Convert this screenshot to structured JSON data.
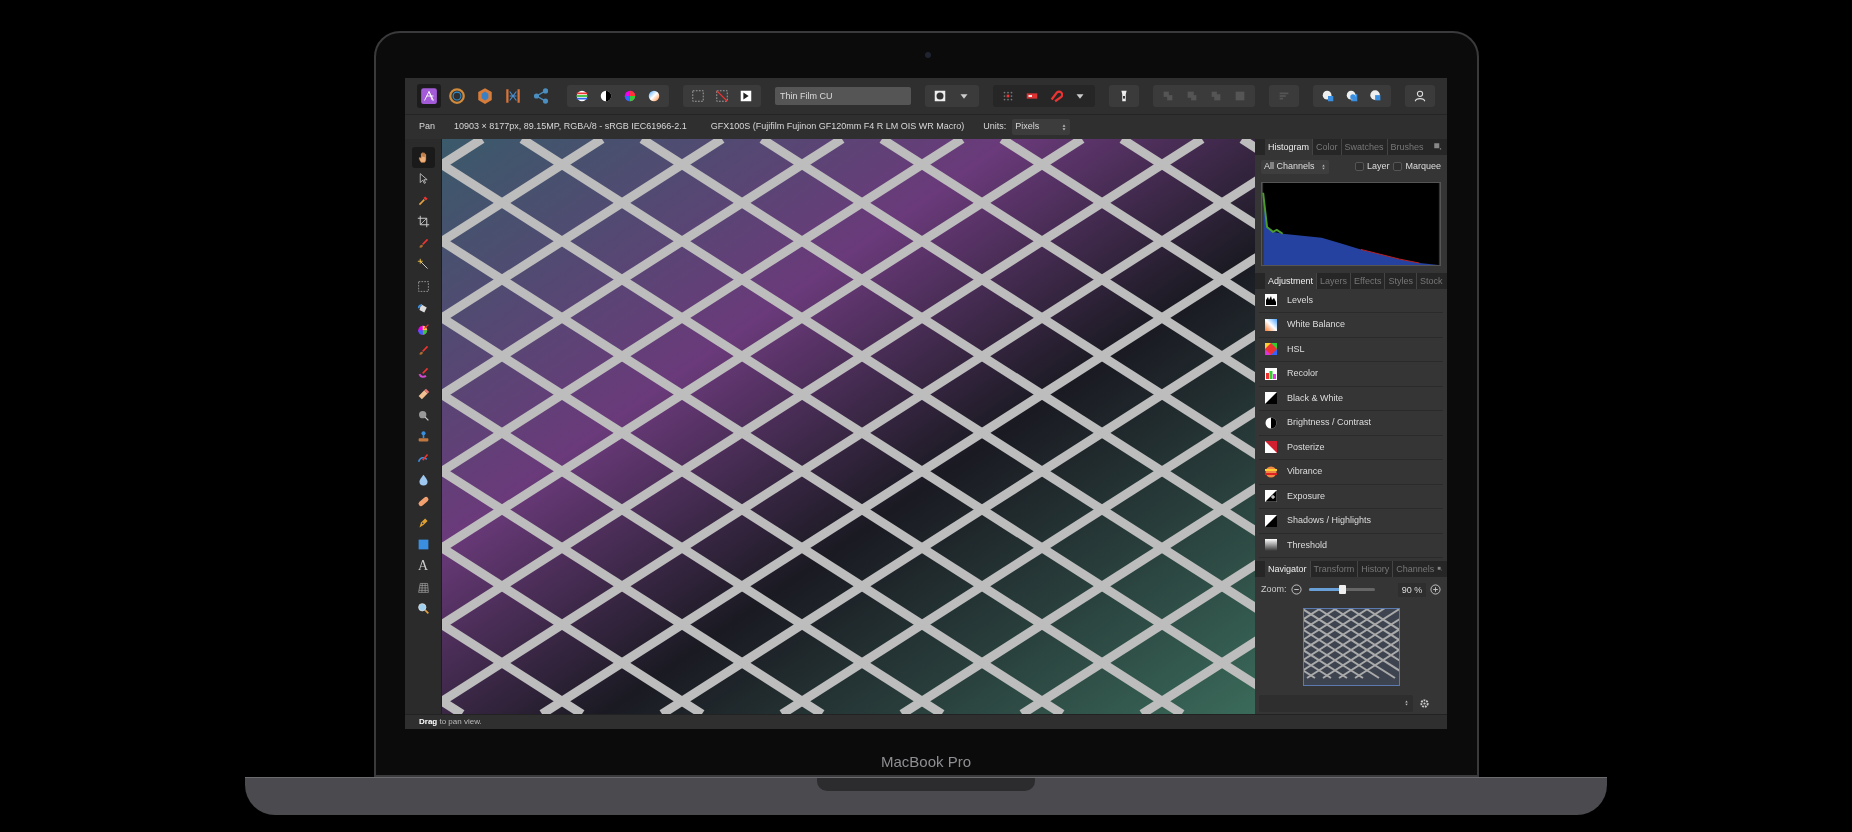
{
  "personas": [
    {
      "selected": true
    },
    {
      "selected": false
    },
    {
      "selected": false
    },
    {
      "selected": false
    },
    {
      "selected": false
    }
  ],
  "style_field": {
    "value": "Thin Film CU"
  },
  "context_bar": {
    "tool": "Pan",
    "document_info": "10903 × 8177px, 89.15MP, RGBA/8 - sRGB IEC61966-2.1",
    "camera_info": "GFX100S (Fujifilm Fujinon GF120mm F4 R LM OIS WR Macro)",
    "units_label": "Units:",
    "units_value": "Pixels"
  },
  "tools": [
    {
      "selected": true
    },
    {
      "selected": false
    },
    {
      "selected": false
    },
    {
      "selected": false
    },
    {
      "selected": false
    },
    {
      "selected": false
    },
    {
      "selected": false
    },
    {
      "selected": false
    },
    {
      "selected": false
    },
    {
      "selected": false
    },
    {
      "selected": false
    },
    {
      "selected": false
    },
    {
      "selected": false
    },
    {
      "selected": false
    },
    {
      "selected": false
    },
    {
      "selected": false
    },
    {
      "selected": false
    },
    {
      "selected": false
    },
    {
      "selected": false
    },
    {
      "selected": false,
      "glyph": "A"
    },
    {
      "selected": false
    },
    {
      "selected": false
    }
  ],
  "histogram_panel": {
    "tabs": [
      {
        "label": "Histogram",
        "selected": true
      },
      {
        "label": "Color",
        "selected": false
      },
      {
        "label": "Swatches",
        "selected": false
      },
      {
        "label": "Brushes",
        "selected": false
      }
    ],
    "channel_select": "All Channels",
    "checkboxes": [
      {
        "label": "Layer",
        "checked": false
      },
      {
        "label": "Marquee",
        "checked": false
      }
    ]
  },
  "adjustment_panel": {
    "tabs": [
      {
        "label": "Adjustment",
        "selected": true
      },
      {
        "label": "Layers",
        "selected": false
      },
      {
        "label": "Effects",
        "selected": false
      },
      {
        "label": "Styles",
        "selected": false
      },
      {
        "label": "Stock",
        "selected": false
      }
    ],
    "items": [
      {
        "label": "Levels"
      },
      {
        "label": "White Balance"
      },
      {
        "label": "HSL"
      },
      {
        "label": "Recolor"
      },
      {
        "label": "Black & White"
      },
      {
        "label": "Brightness / Contrast"
      },
      {
        "label": "Posterize"
      },
      {
        "label": "Vibrance"
      },
      {
        "label": "Exposure"
      },
      {
        "label": "Shadows / Highlights"
      },
      {
        "label": "Threshold"
      }
    ]
  },
  "navigator_panel": {
    "tabs": [
      {
        "label": "Navigator",
        "selected": true
      },
      {
        "label": "Transform",
        "selected": false
      },
      {
        "label": "History",
        "selected": false
      },
      {
        "label": "Channels",
        "selected": false
      }
    ],
    "zoom_label": "Zoom:",
    "zoom": {
      "level": 0.5
    },
    "zoom_value": "90 %"
  },
  "status_bar": "**Drag** to pan view.",
  "laptop_label": "MacBook Pro"
}
